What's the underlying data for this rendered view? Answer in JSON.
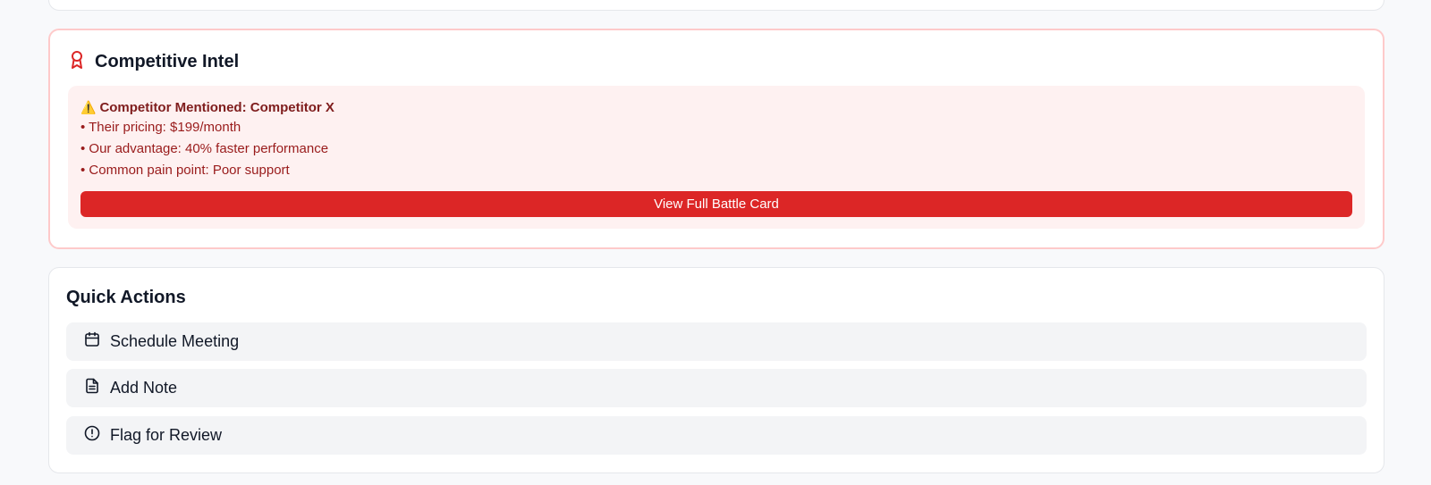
{
  "competitive_intel": {
    "title": "Competitive Intel",
    "icon": "award-icon",
    "accent_color": "#dc2626",
    "alert": {
      "warning_glyph": "⚠️",
      "title": "Competitor Mentioned: Competitor X",
      "lines": [
        "• Their pricing: $199/month",
        "• Our advantage: 40% faster performance",
        "• Common pain point: Poor support"
      ],
      "button_label": "View Full Battle Card"
    }
  },
  "quick_actions": {
    "title": "Quick Actions",
    "items": [
      {
        "label": "Schedule Meeting",
        "icon": "calendar-icon"
      },
      {
        "label": "Add Note",
        "icon": "document-icon"
      },
      {
        "label": "Flag for Review",
        "icon": "alert-circle-icon"
      }
    ]
  }
}
